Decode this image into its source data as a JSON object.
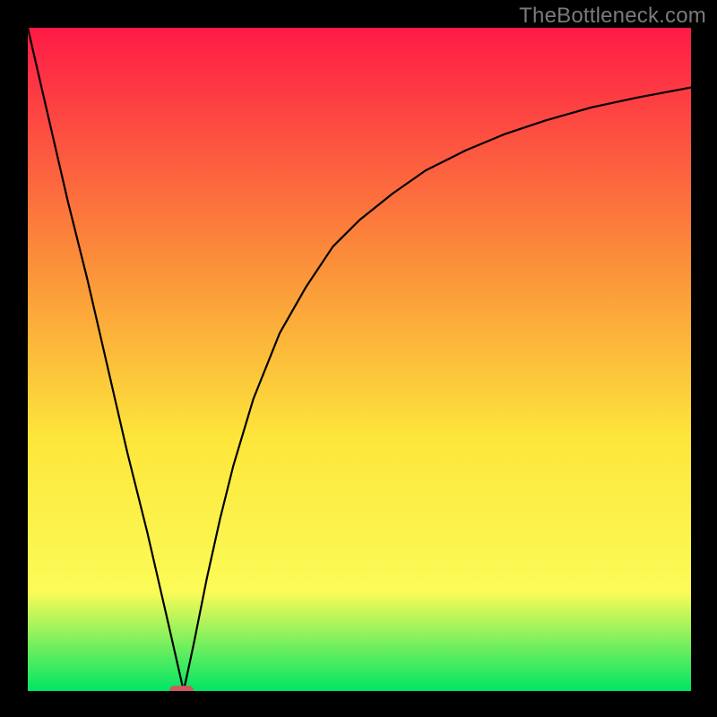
{
  "watermark": "TheBottleneck.com",
  "colors": {
    "gradient_top": "#fe1a46",
    "gradient_mid_upper": "#fb8e3a",
    "gradient_mid": "#fde63b",
    "gradient_lower": "#fcfb57",
    "gradient_bottom": "#00e564",
    "frame": "#000000",
    "curve": "#000000",
    "marker": "#cf5a61"
  },
  "chart_data": {
    "type": "line",
    "title": "",
    "xlabel": "",
    "ylabel": "",
    "xlim": [
      0,
      100
    ],
    "ylim": [
      0,
      100
    ],
    "grid": false,
    "legend": false,
    "annotations": [],
    "series": [
      {
        "name": "bottleneck-curve",
        "x": [
          0,
          3,
          6,
          9,
          12,
          15,
          18,
          21,
          23.5,
          25,
          27,
          29,
          31,
          34,
          38,
          42,
          46,
          50,
          55,
          60,
          66,
          72,
          78,
          85,
          92,
          100
        ],
        "y": [
          100,
          87,
          74,
          62,
          49,
          36,
          24,
          11,
          0,
          7,
          17,
          26,
          34,
          44,
          54,
          61,
          67,
          71,
          75,
          78.5,
          81.5,
          84,
          86,
          88,
          89.5,
          91
        ]
      }
    ],
    "marker": {
      "x": 23.2,
      "y": 0,
      "width": 3.6,
      "height": 1.6
    }
  }
}
